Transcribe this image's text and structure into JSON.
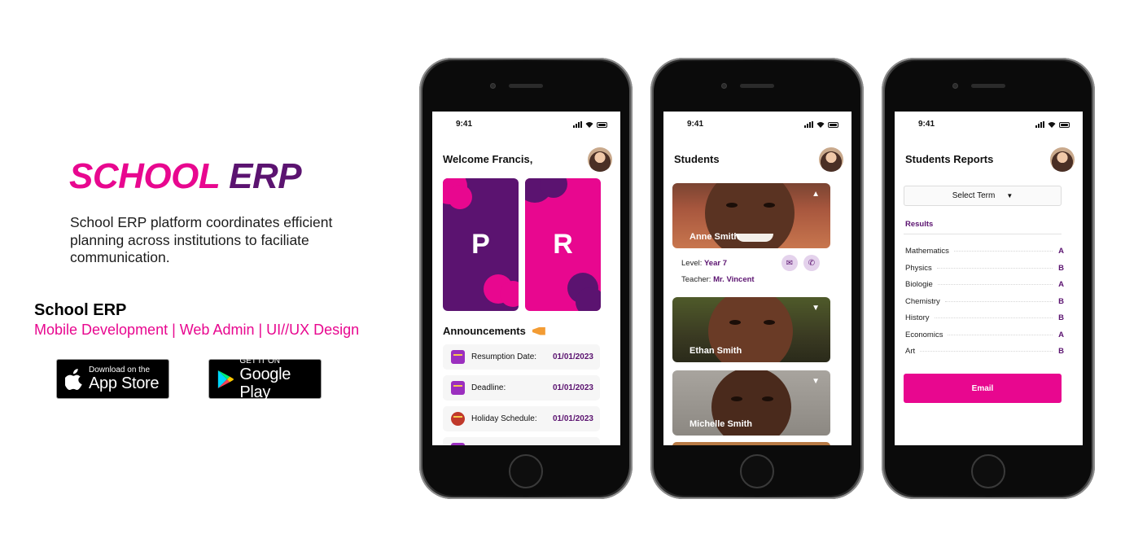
{
  "hero": {
    "title_part1": "SCHOOL",
    "title_part2": "ERP",
    "description": "School ERP platform coordinates efficient planning across institutions to faciliate communication.",
    "brand_name": "School ERP",
    "tags": "Mobile Development | Web Admin | UI//UX Design"
  },
  "badges": {
    "apple": {
      "small": "Download on the",
      "big": "App Store",
      "icon": "apple-icon"
    },
    "google": {
      "small": "GET IT ON",
      "big": "Google Play",
      "icon": "google-play-icon"
    }
  },
  "colors": {
    "primary_pink": "#e8078f",
    "primary_purple": "#5b1370"
  },
  "phone1": {
    "time": "9:41",
    "greeting": "Welcome Francis,",
    "cards": [
      "P",
      "R"
    ],
    "announcements_title": "Announcements",
    "announcements": [
      {
        "label": "Resumption Date:",
        "date": "01/01/2023",
        "icon": "calendar-icon"
      },
      {
        "label": "Deadline:",
        "date": "01/01/2023",
        "icon": "clock-calendar-icon"
      },
      {
        "label": "Holiday Schedule:",
        "date": "01/01/2023",
        "icon": "holiday-icon"
      }
    ]
  },
  "phone2": {
    "time": "9:41",
    "title": "Students",
    "students": [
      {
        "name": "Anne Smith",
        "level_label": "Level:",
        "level": "Year 7",
        "teacher_label": "Teacher:",
        "teacher": "Mr. Vincent",
        "expanded": true
      },
      {
        "name": "Ethan Smith",
        "expanded": false
      },
      {
        "name": "Michelle Smith",
        "expanded": false
      }
    ]
  },
  "phone3": {
    "time": "9:41",
    "title": "Students Reports",
    "select_term": "Select Term",
    "results_label": "Results",
    "results": [
      {
        "subject": "Mathematics",
        "grade": "A"
      },
      {
        "subject": "Physics",
        "grade": "B"
      },
      {
        "subject": "Biologie",
        "grade": "A"
      },
      {
        "subject": "Chemistry",
        "grade": "B"
      },
      {
        "subject": "History",
        "grade": "B"
      },
      {
        "subject": "Economics",
        "grade": "A"
      },
      {
        "subject": "Art",
        "grade": "B"
      }
    ],
    "email_button": "Email"
  }
}
